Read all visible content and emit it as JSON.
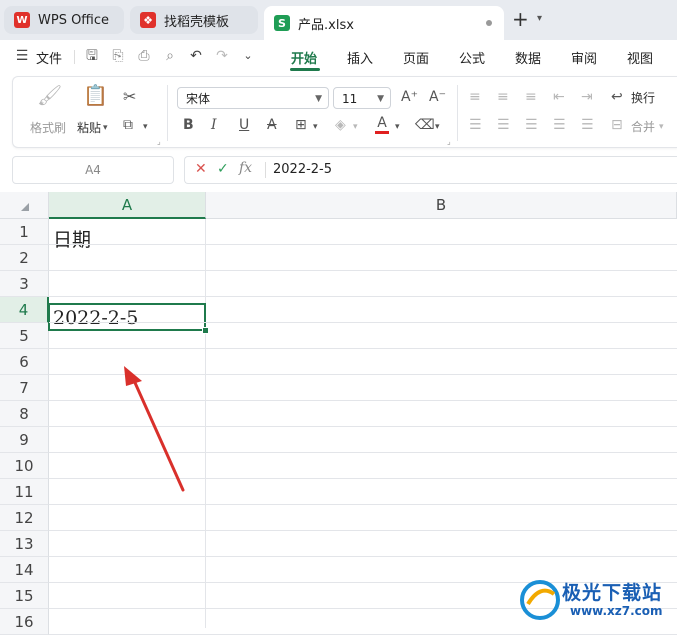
{
  "tabs": [
    {
      "label": "WPS Office",
      "icon": "wps-logo-icon",
      "active": false
    },
    {
      "label": "找稻壳模板",
      "icon": "docer-icon",
      "active": false
    },
    {
      "label": "产品.xlsx",
      "icon": "S",
      "active": true
    }
  ],
  "menu": {
    "file": "文件",
    "tabs": [
      "开始",
      "插入",
      "页面",
      "公式",
      "数据",
      "审阅",
      "视图"
    ]
  },
  "ribbon": {
    "format_painter": "格式刷",
    "paste": "粘贴",
    "font_name": "宋体",
    "font_size": "11",
    "wrap": "换行",
    "merge": "合并"
  },
  "formula_bar": {
    "name_box": "A4",
    "cancel": "✕",
    "confirm": "✓",
    "fx": "fx",
    "value": "2022-2-5"
  },
  "grid": {
    "columns": [
      "A",
      "B"
    ],
    "rows": [
      "1",
      "2",
      "3",
      "4",
      "5",
      "6",
      "7",
      "8",
      "9",
      "10",
      "11",
      "12",
      "13",
      "14",
      "15",
      "16"
    ],
    "cells": {
      "A1": "日期",
      "A4": "2022-2-5"
    },
    "selected_cell": "A4"
  },
  "watermark": {
    "title": "极光下载站",
    "url": "www.xz7.com"
  },
  "colors": {
    "accent": "#1f7a4c",
    "arrow": "#d9302b"
  }
}
